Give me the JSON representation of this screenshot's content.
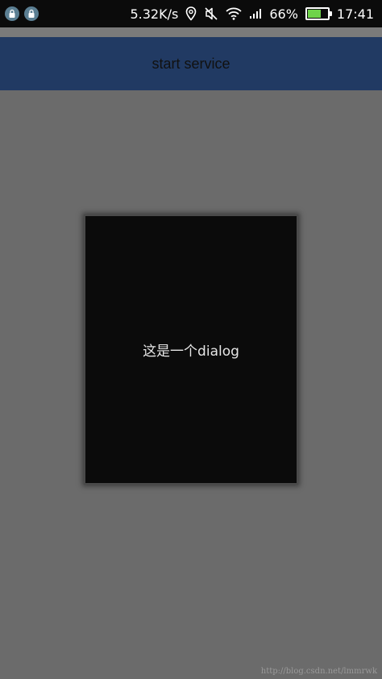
{
  "status_bar": {
    "speed": "5.32K/s",
    "battery_percent": "66%",
    "battery_level": 0.66,
    "time": "17:41",
    "icons": [
      "lock-notification-icon",
      "lock-notification-icon",
      "location-icon",
      "mute-icon",
      "wifi-icon",
      "signal-icon",
      "battery-icon"
    ]
  },
  "action_bar": {
    "title": "start service"
  },
  "dialog": {
    "text": "这是一个dialog"
  },
  "watermark": "http://blog.csdn.net/lmmrwk",
  "colors": {
    "action_bar": "#213a63",
    "dialog_bg": "#0b0b0b",
    "scrim": "#6b6b6b",
    "battery_fill": "#6fd34a"
  }
}
